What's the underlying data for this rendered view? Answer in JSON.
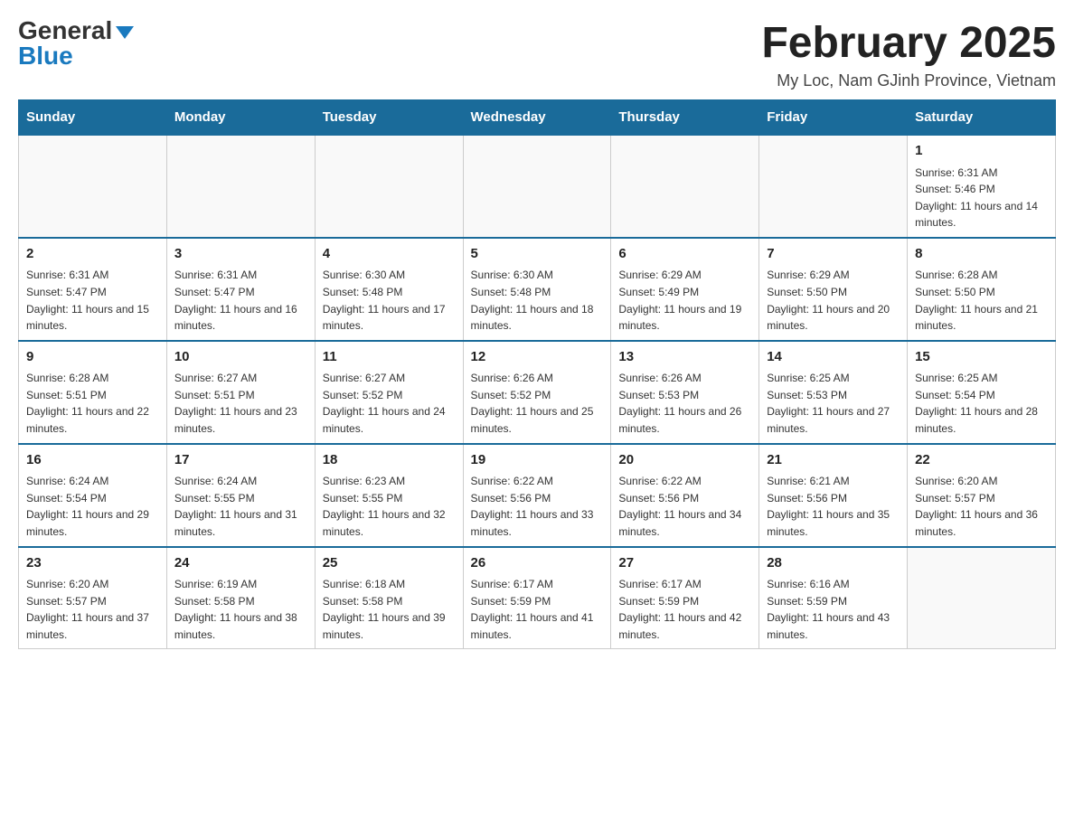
{
  "header": {
    "logo_general": "General",
    "logo_blue": "Blue",
    "month_title": "February 2025",
    "location": "My Loc, Nam GJinh Province, Vietnam"
  },
  "days_of_week": [
    "Sunday",
    "Monday",
    "Tuesday",
    "Wednesday",
    "Thursday",
    "Friday",
    "Saturday"
  ],
  "weeks": [
    [
      {
        "day": "",
        "sunrise": "",
        "sunset": "",
        "daylight": ""
      },
      {
        "day": "",
        "sunrise": "",
        "sunset": "",
        "daylight": ""
      },
      {
        "day": "",
        "sunrise": "",
        "sunset": "",
        "daylight": ""
      },
      {
        "day": "",
        "sunrise": "",
        "sunset": "",
        "daylight": ""
      },
      {
        "day": "",
        "sunrise": "",
        "sunset": "",
        "daylight": ""
      },
      {
        "day": "",
        "sunrise": "",
        "sunset": "",
        "daylight": ""
      },
      {
        "day": "1",
        "sunrise": "Sunrise: 6:31 AM",
        "sunset": "Sunset: 5:46 PM",
        "daylight": "Daylight: 11 hours and 14 minutes."
      }
    ],
    [
      {
        "day": "2",
        "sunrise": "Sunrise: 6:31 AM",
        "sunset": "Sunset: 5:47 PM",
        "daylight": "Daylight: 11 hours and 15 minutes."
      },
      {
        "day": "3",
        "sunrise": "Sunrise: 6:31 AM",
        "sunset": "Sunset: 5:47 PM",
        "daylight": "Daylight: 11 hours and 16 minutes."
      },
      {
        "day": "4",
        "sunrise": "Sunrise: 6:30 AM",
        "sunset": "Sunset: 5:48 PM",
        "daylight": "Daylight: 11 hours and 17 minutes."
      },
      {
        "day": "5",
        "sunrise": "Sunrise: 6:30 AM",
        "sunset": "Sunset: 5:48 PM",
        "daylight": "Daylight: 11 hours and 18 minutes."
      },
      {
        "day": "6",
        "sunrise": "Sunrise: 6:29 AM",
        "sunset": "Sunset: 5:49 PM",
        "daylight": "Daylight: 11 hours and 19 minutes."
      },
      {
        "day": "7",
        "sunrise": "Sunrise: 6:29 AM",
        "sunset": "Sunset: 5:50 PM",
        "daylight": "Daylight: 11 hours and 20 minutes."
      },
      {
        "day": "8",
        "sunrise": "Sunrise: 6:28 AM",
        "sunset": "Sunset: 5:50 PM",
        "daylight": "Daylight: 11 hours and 21 minutes."
      }
    ],
    [
      {
        "day": "9",
        "sunrise": "Sunrise: 6:28 AM",
        "sunset": "Sunset: 5:51 PM",
        "daylight": "Daylight: 11 hours and 22 minutes."
      },
      {
        "day": "10",
        "sunrise": "Sunrise: 6:27 AM",
        "sunset": "Sunset: 5:51 PM",
        "daylight": "Daylight: 11 hours and 23 minutes."
      },
      {
        "day": "11",
        "sunrise": "Sunrise: 6:27 AM",
        "sunset": "Sunset: 5:52 PM",
        "daylight": "Daylight: 11 hours and 24 minutes."
      },
      {
        "day": "12",
        "sunrise": "Sunrise: 6:26 AM",
        "sunset": "Sunset: 5:52 PM",
        "daylight": "Daylight: 11 hours and 25 minutes."
      },
      {
        "day": "13",
        "sunrise": "Sunrise: 6:26 AM",
        "sunset": "Sunset: 5:53 PM",
        "daylight": "Daylight: 11 hours and 26 minutes."
      },
      {
        "day": "14",
        "sunrise": "Sunrise: 6:25 AM",
        "sunset": "Sunset: 5:53 PM",
        "daylight": "Daylight: 11 hours and 27 minutes."
      },
      {
        "day": "15",
        "sunrise": "Sunrise: 6:25 AM",
        "sunset": "Sunset: 5:54 PM",
        "daylight": "Daylight: 11 hours and 28 minutes."
      }
    ],
    [
      {
        "day": "16",
        "sunrise": "Sunrise: 6:24 AM",
        "sunset": "Sunset: 5:54 PM",
        "daylight": "Daylight: 11 hours and 29 minutes."
      },
      {
        "day": "17",
        "sunrise": "Sunrise: 6:24 AM",
        "sunset": "Sunset: 5:55 PM",
        "daylight": "Daylight: 11 hours and 31 minutes."
      },
      {
        "day": "18",
        "sunrise": "Sunrise: 6:23 AM",
        "sunset": "Sunset: 5:55 PM",
        "daylight": "Daylight: 11 hours and 32 minutes."
      },
      {
        "day": "19",
        "sunrise": "Sunrise: 6:22 AM",
        "sunset": "Sunset: 5:56 PM",
        "daylight": "Daylight: 11 hours and 33 minutes."
      },
      {
        "day": "20",
        "sunrise": "Sunrise: 6:22 AM",
        "sunset": "Sunset: 5:56 PM",
        "daylight": "Daylight: 11 hours and 34 minutes."
      },
      {
        "day": "21",
        "sunrise": "Sunrise: 6:21 AM",
        "sunset": "Sunset: 5:56 PM",
        "daylight": "Daylight: 11 hours and 35 minutes."
      },
      {
        "day": "22",
        "sunrise": "Sunrise: 6:20 AM",
        "sunset": "Sunset: 5:57 PM",
        "daylight": "Daylight: 11 hours and 36 minutes."
      }
    ],
    [
      {
        "day": "23",
        "sunrise": "Sunrise: 6:20 AM",
        "sunset": "Sunset: 5:57 PM",
        "daylight": "Daylight: 11 hours and 37 minutes."
      },
      {
        "day": "24",
        "sunrise": "Sunrise: 6:19 AM",
        "sunset": "Sunset: 5:58 PM",
        "daylight": "Daylight: 11 hours and 38 minutes."
      },
      {
        "day": "25",
        "sunrise": "Sunrise: 6:18 AM",
        "sunset": "Sunset: 5:58 PM",
        "daylight": "Daylight: 11 hours and 39 minutes."
      },
      {
        "day": "26",
        "sunrise": "Sunrise: 6:17 AM",
        "sunset": "Sunset: 5:59 PM",
        "daylight": "Daylight: 11 hours and 41 minutes."
      },
      {
        "day": "27",
        "sunrise": "Sunrise: 6:17 AM",
        "sunset": "Sunset: 5:59 PM",
        "daylight": "Daylight: 11 hours and 42 minutes."
      },
      {
        "day": "28",
        "sunrise": "Sunrise: 6:16 AM",
        "sunset": "Sunset: 5:59 PM",
        "daylight": "Daylight: 11 hours and 43 minutes."
      },
      {
        "day": "",
        "sunrise": "",
        "sunset": "",
        "daylight": ""
      }
    ]
  ]
}
